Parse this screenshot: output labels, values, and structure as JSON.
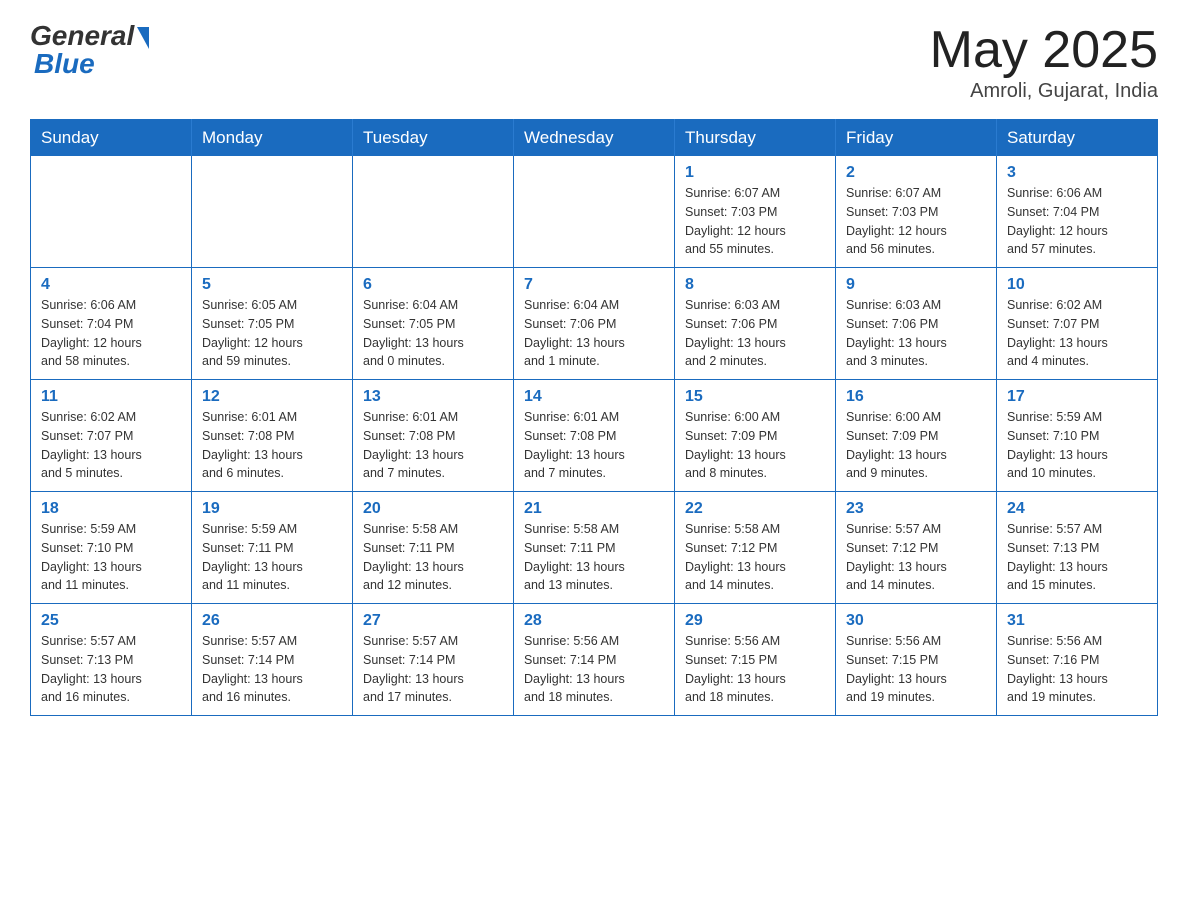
{
  "header": {
    "logo_general": "General",
    "logo_blue": "Blue",
    "month_year": "May 2025",
    "location": "Amroli, Gujarat, India"
  },
  "days_of_week": [
    "Sunday",
    "Monday",
    "Tuesday",
    "Wednesday",
    "Thursday",
    "Friday",
    "Saturday"
  ],
  "weeks": [
    [
      {
        "day": "",
        "info": ""
      },
      {
        "day": "",
        "info": ""
      },
      {
        "day": "",
        "info": ""
      },
      {
        "day": "",
        "info": ""
      },
      {
        "day": "1",
        "info": "Sunrise: 6:07 AM\nSunset: 7:03 PM\nDaylight: 12 hours\nand 55 minutes."
      },
      {
        "day": "2",
        "info": "Sunrise: 6:07 AM\nSunset: 7:03 PM\nDaylight: 12 hours\nand 56 minutes."
      },
      {
        "day": "3",
        "info": "Sunrise: 6:06 AM\nSunset: 7:04 PM\nDaylight: 12 hours\nand 57 minutes."
      }
    ],
    [
      {
        "day": "4",
        "info": "Sunrise: 6:06 AM\nSunset: 7:04 PM\nDaylight: 12 hours\nand 58 minutes."
      },
      {
        "day": "5",
        "info": "Sunrise: 6:05 AM\nSunset: 7:05 PM\nDaylight: 12 hours\nand 59 minutes."
      },
      {
        "day": "6",
        "info": "Sunrise: 6:04 AM\nSunset: 7:05 PM\nDaylight: 13 hours\nand 0 minutes."
      },
      {
        "day": "7",
        "info": "Sunrise: 6:04 AM\nSunset: 7:06 PM\nDaylight: 13 hours\nand 1 minute."
      },
      {
        "day": "8",
        "info": "Sunrise: 6:03 AM\nSunset: 7:06 PM\nDaylight: 13 hours\nand 2 minutes."
      },
      {
        "day": "9",
        "info": "Sunrise: 6:03 AM\nSunset: 7:06 PM\nDaylight: 13 hours\nand 3 minutes."
      },
      {
        "day": "10",
        "info": "Sunrise: 6:02 AM\nSunset: 7:07 PM\nDaylight: 13 hours\nand 4 minutes."
      }
    ],
    [
      {
        "day": "11",
        "info": "Sunrise: 6:02 AM\nSunset: 7:07 PM\nDaylight: 13 hours\nand 5 minutes."
      },
      {
        "day": "12",
        "info": "Sunrise: 6:01 AM\nSunset: 7:08 PM\nDaylight: 13 hours\nand 6 minutes."
      },
      {
        "day": "13",
        "info": "Sunrise: 6:01 AM\nSunset: 7:08 PM\nDaylight: 13 hours\nand 7 minutes."
      },
      {
        "day": "14",
        "info": "Sunrise: 6:01 AM\nSunset: 7:08 PM\nDaylight: 13 hours\nand 7 minutes."
      },
      {
        "day": "15",
        "info": "Sunrise: 6:00 AM\nSunset: 7:09 PM\nDaylight: 13 hours\nand 8 minutes."
      },
      {
        "day": "16",
        "info": "Sunrise: 6:00 AM\nSunset: 7:09 PM\nDaylight: 13 hours\nand 9 minutes."
      },
      {
        "day": "17",
        "info": "Sunrise: 5:59 AM\nSunset: 7:10 PM\nDaylight: 13 hours\nand 10 minutes."
      }
    ],
    [
      {
        "day": "18",
        "info": "Sunrise: 5:59 AM\nSunset: 7:10 PM\nDaylight: 13 hours\nand 11 minutes."
      },
      {
        "day": "19",
        "info": "Sunrise: 5:59 AM\nSunset: 7:11 PM\nDaylight: 13 hours\nand 11 minutes."
      },
      {
        "day": "20",
        "info": "Sunrise: 5:58 AM\nSunset: 7:11 PM\nDaylight: 13 hours\nand 12 minutes."
      },
      {
        "day": "21",
        "info": "Sunrise: 5:58 AM\nSunset: 7:11 PM\nDaylight: 13 hours\nand 13 minutes."
      },
      {
        "day": "22",
        "info": "Sunrise: 5:58 AM\nSunset: 7:12 PM\nDaylight: 13 hours\nand 14 minutes."
      },
      {
        "day": "23",
        "info": "Sunrise: 5:57 AM\nSunset: 7:12 PM\nDaylight: 13 hours\nand 14 minutes."
      },
      {
        "day": "24",
        "info": "Sunrise: 5:57 AM\nSunset: 7:13 PM\nDaylight: 13 hours\nand 15 minutes."
      }
    ],
    [
      {
        "day": "25",
        "info": "Sunrise: 5:57 AM\nSunset: 7:13 PM\nDaylight: 13 hours\nand 16 minutes."
      },
      {
        "day": "26",
        "info": "Sunrise: 5:57 AM\nSunset: 7:14 PM\nDaylight: 13 hours\nand 16 minutes."
      },
      {
        "day": "27",
        "info": "Sunrise: 5:57 AM\nSunset: 7:14 PM\nDaylight: 13 hours\nand 17 minutes."
      },
      {
        "day": "28",
        "info": "Sunrise: 5:56 AM\nSunset: 7:14 PM\nDaylight: 13 hours\nand 18 minutes."
      },
      {
        "day": "29",
        "info": "Sunrise: 5:56 AM\nSunset: 7:15 PM\nDaylight: 13 hours\nand 18 minutes."
      },
      {
        "day": "30",
        "info": "Sunrise: 5:56 AM\nSunset: 7:15 PM\nDaylight: 13 hours\nand 19 minutes."
      },
      {
        "day": "31",
        "info": "Sunrise: 5:56 AM\nSunset: 7:16 PM\nDaylight: 13 hours\nand 19 minutes."
      }
    ]
  ]
}
